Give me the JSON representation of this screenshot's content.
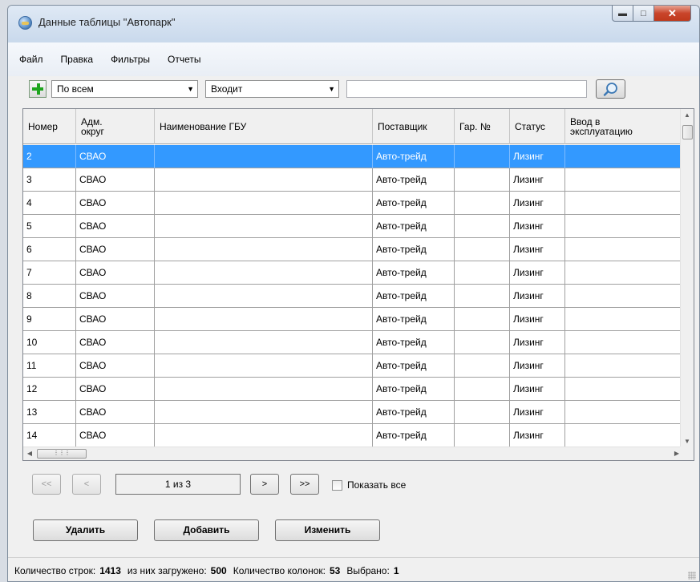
{
  "window": {
    "title": "Данные таблицы \"Автопарк\""
  },
  "menu": [
    "Файл",
    "Правка",
    "Фильтры",
    "Отчеты"
  ],
  "toolbar": {
    "field_select": "По всем",
    "condition_select": "Входит",
    "search_value": ""
  },
  "table": {
    "columns": [
      "Номер",
      "Адм. округ",
      "Наименование ГБУ",
      "Поставщик",
      "Гар. №",
      "Статус",
      "Ввод в эксплуатацию"
    ],
    "rows": [
      [
        "2",
        "СВАО",
        "",
        "Авто-трейд",
        "",
        "Лизинг",
        ""
      ],
      [
        "3",
        "СВАО",
        "",
        "Авто-трейд",
        "",
        "Лизинг",
        ""
      ],
      [
        "4",
        "СВАО",
        "",
        "Авто-трейд",
        "",
        "Лизинг",
        ""
      ],
      [
        "5",
        "СВАО",
        "",
        "Авто-трейд",
        "",
        "Лизинг",
        ""
      ],
      [
        "6",
        "СВАО",
        "",
        "Авто-трейд",
        "",
        "Лизинг",
        ""
      ],
      [
        "7",
        "СВАО",
        "",
        "Авто-трейд",
        "",
        "Лизинг",
        ""
      ],
      [
        "8",
        "СВАО",
        "",
        "Авто-трейд",
        "",
        "Лизинг",
        ""
      ],
      [
        "9",
        "СВАО",
        "",
        "Авто-трейд",
        "",
        "Лизинг",
        ""
      ],
      [
        "10",
        "СВАО",
        "",
        "Авто-трейд",
        "",
        "Лизинг",
        ""
      ],
      [
        "11",
        "СВАО",
        "",
        "Авто-трейд",
        "",
        "Лизинг",
        ""
      ],
      [
        "12",
        "СВАО",
        "",
        "Авто-трейд",
        "",
        "Лизинг",
        ""
      ],
      [
        "13",
        "СВАО",
        "",
        "Авто-трейд",
        "",
        "Лизинг",
        ""
      ],
      [
        "14",
        "СВАО",
        "",
        "Авто-трейд",
        "",
        "Лизинг",
        ""
      ]
    ],
    "selected_row": 0
  },
  "pager": {
    "first": "<<",
    "prev": "<",
    "page_text": "1 из 3",
    "next": ">",
    "last": ">>",
    "show_all_label": "Показать все",
    "show_all_checked": false
  },
  "actions": {
    "delete": "Удалить",
    "add": "Добавить",
    "edit": "Изменить"
  },
  "status": {
    "rows_label": "Количество строк:",
    "rows_value": "1413",
    "loaded_label": "из них загружено:",
    "loaded_value": "500",
    "cols_label": "Количество колонок:",
    "cols_value": "53",
    "selected_label": "Выбрано:",
    "selected_value": "1"
  },
  "colors": {
    "selection": "#3399ff",
    "close_button": "#c9452b"
  }
}
